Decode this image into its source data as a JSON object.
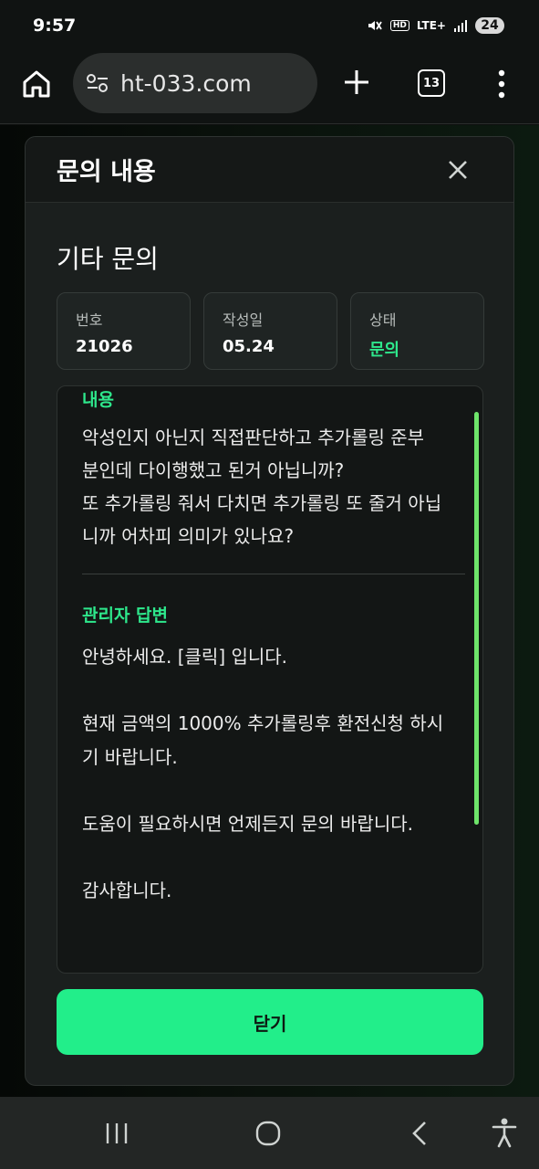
{
  "status_bar": {
    "time": "9:57",
    "hd": "HD",
    "network": "LTE+",
    "battery": "24"
  },
  "browser": {
    "url": "ht-033.com",
    "tab_count": "13"
  },
  "modal": {
    "title": "문의 내용",
    "inquiry_title": "기타 문의",
    "info": [
      {
        "label": "번호",
        "value": "21026"
      },
      {
        "label": "작성일",
        "value": "05.24"
      },
      {
        "label": "상태",
        "value": "문의"
      }
    ],
    "content_label": "내용",
    "content_text": "악성인지 아닌지 직접판단하고 추가롤링 준부\n분인데 다이행했고 된거 아닙니까?\n또 추가롤링 줘서 다치면 추가롤링 또 줄거 아닙\n니까 어차피 의미가 있나요?",
    "answer_label": "관리자 답변",
    "answer_text": "안녕하세요. [클릭] 입니다.\n\n현재 금액의 1000% 추가롤링후 환전신청 하시\n기 바랍니다.\n\n도움이 필요하시면 언제든지 문의 바랍니다.\n\n감사합니다.",
    "close_button": "닫기"
  },
  "colors": {
    "accent": "#22ee8a",
    "status_green": "#2ee88c",
    "scrollbar": "#6ee46a"
  }
}
